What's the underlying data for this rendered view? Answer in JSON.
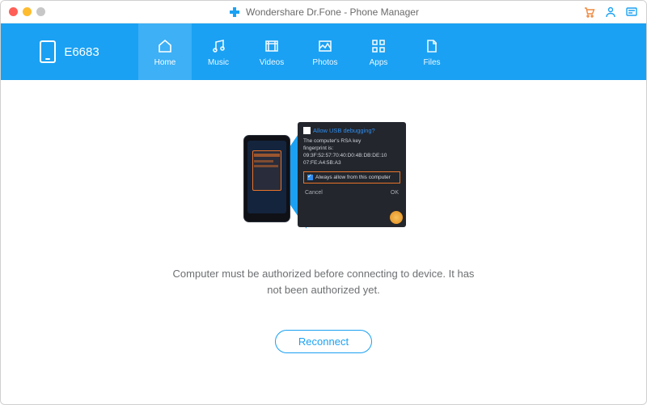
{
  "titlebar": {
    "app_title": "Wondershare Dr.Fone - Phone Manager"
  },
  "header": {
    "device_name": "E6683",
    "tabs": [
      {
        "label": "Home"
      },
      {
        "label": "Music"
      },
      {
        "label": "Videos"
      },
      {
        "label": "Photos"
      },
      {
        "label": "Apps"
      },
      {
        "label": "Files"
      }
    ]
  },
  "usb_dialog": {
    "title": "Allow USB debugging?",
    "body_line1": "The computer's RSA key",
    "body_line2": "fingerprint is:",
    "body_line3": "09:3F:52:57:70:40:D0:4B:DB:DE:10",
    "body_line4": "07:FE:A4:5B:A3",
    "always_allow": "Always allow from this computer",
    "cancel": "Cancel",
    "ok": "OK"
  },
  "main": {
    "message": "Computer must be authorized before connecting to device. It has not been authorized yet.",
    "reconnect_label": "Reconnect"
  },
  "colors": {
    "accent": "#1aa1f3",
    "highlight": "#e8732a"
  }
}
